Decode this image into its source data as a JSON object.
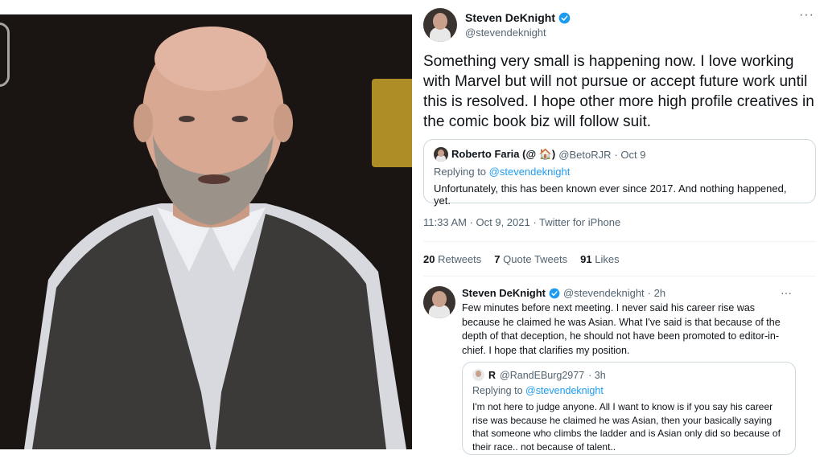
{
  "tweet": {
    "author_name": "Steven DeKnight",
    "author_handle": "@stevendeknight",
    "text": "Something very small is happening now. I love working with Marvel but will not pursue or accept future work until this is resolved. I hope other more high profile creatives in the comic book biz will follow suit.",
    "more_label": "···",
    "timestamp": "11:33 AM · Oct 9, 2021 · Twitter for iPhone",
    "quoted": {
      "name": "Roberto Faria (@ 🏠)",
      "handle": "@BetoRJR",
      "date": "· Oct 9",
      "replying_prefix": "Replying to ",
      "replying_to": "@stevendeknight",
      "text": "Unfortunately, this has been known ever since 2017. And nothing happened, yet."
    },
    "stats": [
      {
        "count": "20",
        "label": "Retweets"
      },
      {
        "count": "7",
        "label": "Quote Tweets"
      },
      {
        "count": "91",
        "label": "Likes"
      }
    ]
  },
  "reply": {
    "author_name": "Steven DeKnight",
    "author_handle": "@stevendeknight",
    "time": "· 2h",
    "more_label": "···",
    "text": "Few minutes before next meeting. I never said his career rise was because he claimed he was Asian. What I've said is that because of the depth of that deception, he should not have been promoted to editor-in-chief. I hope that clarifies my position.",
    "quoted": {
      "name": "R",
      "handle": "@RandEBurg2977",
      "time": "· 3h",
      "replying_prefix": "Replying to ",
      "replying_to": "@stevendeknight",
      "text": "I'm not here to judge anyone. All I want to know is if you say his career rise was because he claimed he was Asian, then your basically saying that someone who climbs the ladder and is Asian only did so because of their race..  not because of talent.."
    }
  },
  "colors": {
    "link": "#1d9bf0",
    "verified": "#1d9bf0",
    "secondary_text": "#536471",
    "border": "#cfd9de"
  }
}
